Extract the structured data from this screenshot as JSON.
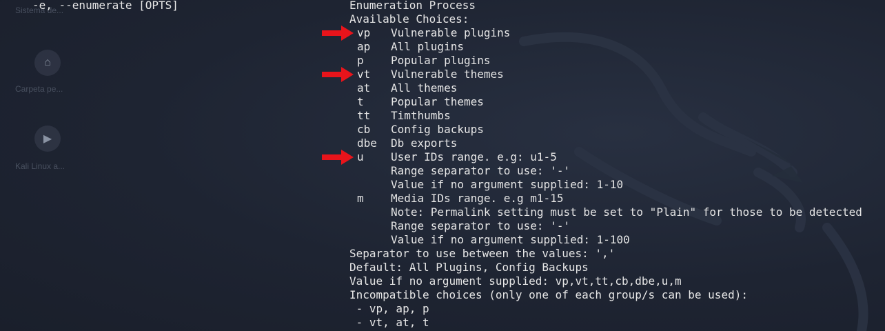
{
  "desktop": {
    "items": [
      {
        "label": "Sistema de...",
        "icon": "folder-icon"
      },
      {
        "label": "Carpeta pe...",
        "icon": "home-icon",
        "glyph": "⌂"
      },
      {
        "label": "Kali Linux a...",
        "icon": "play-icon",
        "glyph": "▶"
      }
    ]
  },
  "terminal": {
    "option_flag": "-e, --enumerate [OPTS]",
    "heading": "Enumeration Process",
    "choices_heading": "Available Choices:",
    "choices": [
      {
        "key": "vp",
        "desc": "Vulnerable plugins",
        "highlighted": true
      },
      {
        "key": "ap",
        "desc": "All plugins"
      },
      {
        "key": "p",
        "desc": "Popular plugins"
      },
      {
        "key": "vt",
        "desc": "Vulnerable themes",
        "highlighted": true
      },
      {
        "key": "at",
        "desc": "All themes"
      },
      {
        "key": "t",
        "desc": "Popular themes"
      },
      {
        "key": "tt",
        "desc": "Timthumbs"
      },
      {
        "key": "cb",
        "desc": "Config backups"
      },
      {
        "key": "dbe",
        "desc": "Db exports"
      },
      {
        "key": "u",
        "desc": "User IDs range. e.g: u1-5",
        "highlighted": true
      },
      {
        "key": "",
        "desc": "Range separator to use: '-'"
      },
      {
        "key": "",
        "desc": "Value if no argument supplied: 1-10"
      },
      {
        "key": "m",
        "desc": "Media IDs range. e.g m1-15"
      },
      {
        "key": "",
        "desc": "Note: Permalink setting must be set to \"Plain\" for those to be detected"
      },
      {
        "key": "",
        "desc": "Range separator to use: '-'"
      },
      {
        "key": "",
        "desc": "Value if no argument supplied: 1-100"
      }
    ],
    "footer_lines": [
      "Separator to use between the values: ','",
      "Default: All Plugins, Config Backups",
      "Value if no argument supplied: vp,vt,tt,cb,dbe,u,m",
      "Incompatible choices (only one of each group/s can be used):",
      " - vp, ap, p",
      " - vt, at, t"
    ],
    "text_color": "#e6e6e6",
    "arrow_color": "#e8141b"
  }
}
